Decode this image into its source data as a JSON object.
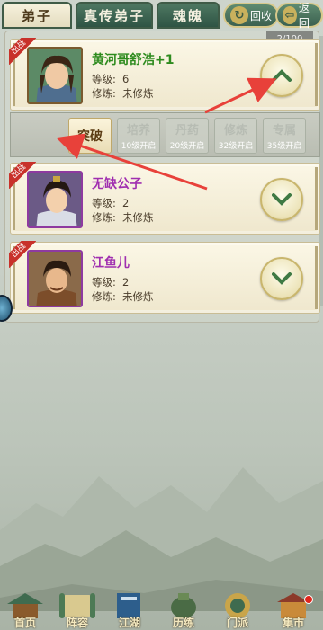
{
  "tabs": [
    {
      "label": "弟子",
      "active": true
    },
    {
      "label": "真传弟子",
      "active": false
    },
    {
      "label": "魂魄",
      "active": false
    }
  ],
  "recycle_label": "回收",
  "back_label": "返回",
  "counter": "2/100",
  "disciples": [
    {
      "badge": "出战",
      "name": "黄河哥舒浩+1",
      "name_color": "#2e8b1e",
      "level_label": "等级:",
      "level": "6",
      "train_label": "修炼:",
      "train": "未修炼",
      "expanded": true
    },
    {
      "badge": "出战",
      "name": "无缺公子",
      "name_color": "#a02fb0",
      "level_label": "等级:",
      "level": "2",
      "train_label": "修炼:",
      "train": "未修炼",
      "expanded": false
    },
    {
      "badge": "出战",
      "name": "江鱼儿",
      "name_color": "#a02fb0",
      "level_label": "等级:",
      "level": "2",
      "train_label": "修炼:",
      "train": "未修炼",
      "expanded": false
    }
  ],
  "skills": [
    {
      "title": "突破",
      "sub": "",
      "active": true
    },
    {
      "title": "培养",
      "sub": "10级开启",
      "active": false
    },
    {
      "title": "丹药",
      "sub": "20级开启",
      "active": false
    },
    {
      "title": "修炼",
      "sub": "32级开启",
      "active": false
    },
    {
      "title": "专属",
      "sub": "35级开启",
      "active": false
    }
  ],
  "bottom_nav": [
    {
      "label": "首页",
      "icon": "house-icon"
    },
    {
      "label": "阵容",
      "icon": "scroll-icon"
    },
    {
      "label": "江湖",
      "icon": "book-icon"
    },
    {
      "label": "历练",
      "icon": "jar-icon"
    },
    {
      "label": "门派",
      "icon": "emblem-icon"
    },
    {
      "label": "集市",
      "icon": "shop-icon"
    }
  ],
  "colors": {
    "accent_green": "#3c6150",
    "arrow_red": "#e8413a"
  }
}
